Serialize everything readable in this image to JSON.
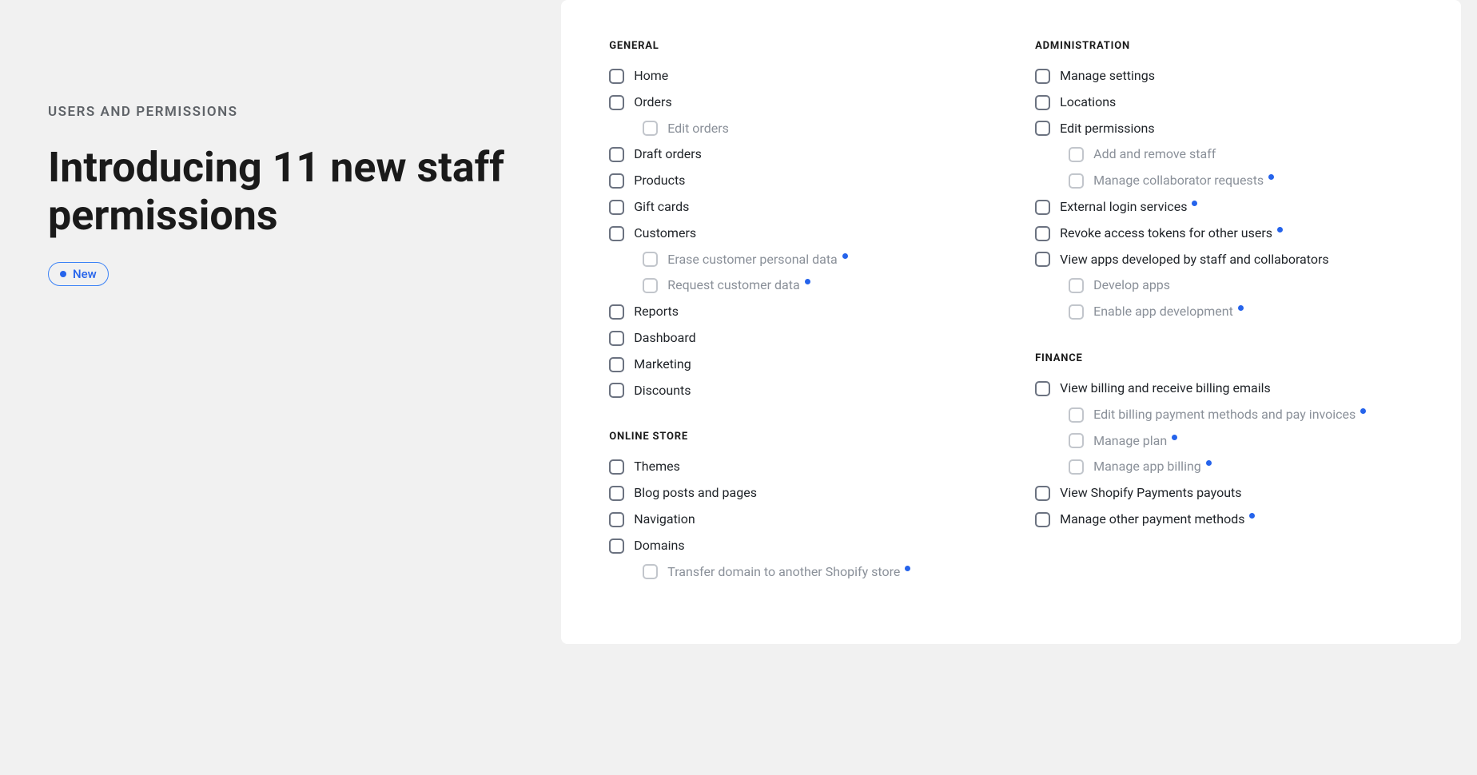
{
  "left": {
    "eyebrow": "USERS AND PERMISSIONS",
    "headline": "Introducing 11 new staff permissions",
    "badge_label": "New"
  },
  "sections": [
    {
      "title": "GENERAL",
      "column": 0,
      "items": [
        {
          "label": "Home",
          "sub": false,
          "new": false
        },
        {
          "label": "Orders",
          "sub": false,
          "new": false
        },
        {
          "label": "Edit orders",
          "sub": true,
          "new": false
        },
        {
          "label": "Draft orders",
          "sub": false,
          "new": false
        },
        {
          "label": "Products",
          "sub": false,
          "new": false
        },
        {
          "label": "Gift cards",
          "sub": false,
          "new": false
        },
        {
          "label": "Customers",
          "sub": false,
          "new": false
        },
        {
          "label": "Erase customer personal data",
          "sub": true,
          "new": true
        },
        {
          "label": "Request customer data",
          "sub": true,
          "new": true
        },
        {
          "label": "Reports",
          "sub": false,
          "new": false
        },
        {
          "label": "Dashboard",
          "sub": false,
          "new": false
        },
        {
          "label": "Marketing",
          "sub": false,
          "new": false
        },
        {
          "label": "Discounts",
          "sub": false,
          "new": false
        }
      ]
    },
    {
      "title": "ONLINE STORE",
      "column": 0,
      "items": [
        {
          "label": "Themes",
          "sub": false,
          "new": false
        },
        {
          "label": "Blog posts and pages",
          "sub": false,
          "new": false
        },
        {
          "label": "Navigation",
          "sub": false,
          "new": false
        },
        {
          "label": "Domains",
          "sub": false,
          "new": false
        },
        {
          "label": "Transfer domain to another Shopify store",
          "sub": true,
          "new": true
        }
      ]
    },
    {
      "title": "ADMINISTRATION",
      "column": 1,
      "items": [
        {
          "label": "Manage settings",
          "sub": false,
          "new": false
        },
        {
          "label": "Locations",
          "sub": false,
          "new": false
        },
        {
          "label": "Edit permissions",
          "sub": false,
          "new": false
        },
        {
          "label": "Add and remove staff",
          "sub": true,
          "new": false
        },
        {
          "label": "Manage collaborator requests",
          "sub": true,
          "new": true
        },
        {
          "label": "External login services",
          "sub": false,
          "new": true
        },
        {
          "label": "Revoke access tokens for other users",
          "sub": false,
          "new": true
        },
        {
          "label": "View apps developed by staff and collaborators",
          "sub": false,
          "new": false
        },
        {
          "label": "Develop apps",
          "sub": true,
          "new": false
        },
        {
          "label": "Enable app development",
          "sub": true,
          "new": true
        }
      ]
    },
    {
      "title": "FINANCE",
      "column": 1,
      "items": [
        {
          "label": "View billing and receive billing emails",
          "sub": false,
          "new": false
        },
        {
          "label": "Edit billing payment methods and pay invoices",
          "sub": true,
          "new": true
        },
        {
          "label": "Manage plan",
          "sub": true,
          "new": true
        },
        {
          "label": "Manage app billing",
          "sub": true,
          "new": true
        },
        {
          "label": "View Shopify Payments payouts",
          "sub": false,
          "new": false
        },
        {
          "label": "Manage other payment methods",
          "sub": false,
          "new": true
        }
      ]
    }
  ]
}
